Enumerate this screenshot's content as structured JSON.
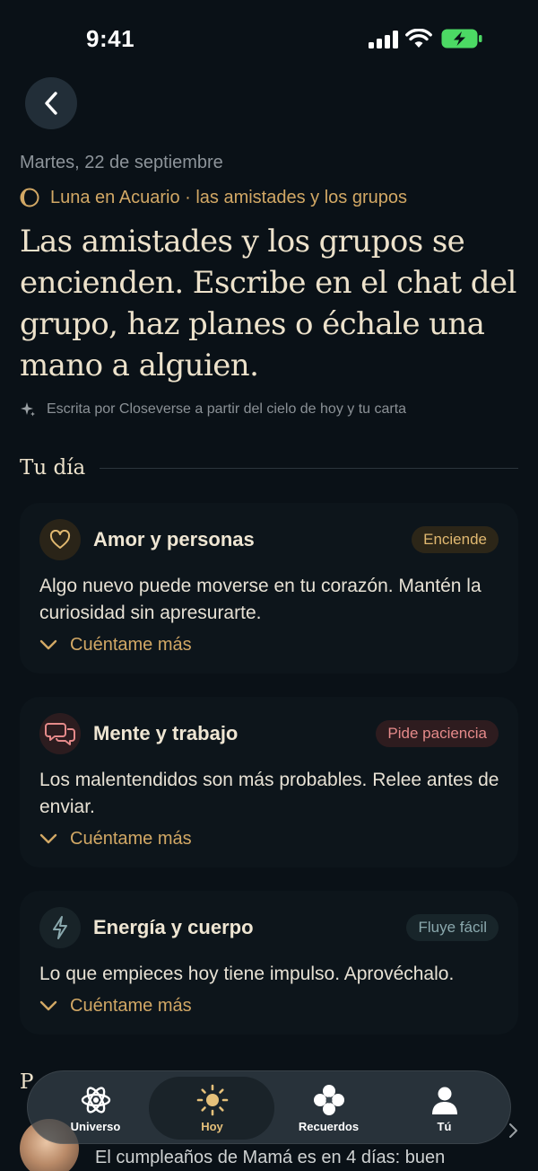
{
  "status": {
    "time": "9:41"
  },
  "header": {
    "date": "Martes, 22 de septiembre",
    "transit": "Luna en Acuario · las amistades y los grupos",
    "headline": "Las amistades y los grupos se encienden. Escribe en el chat del grupo, haz planes o échale una mano a alguien.",
    "attribution": "Escrita por Closeverse a partir del cielo de hoy y tu carta"
  },
  "section": {
    "title": "Tu día"
  },
  "cards": [
    {
      "title": "Amor y personas",
      "badge": "Enciende",
      "body": "Algo nuevo puede moverse en tu corazón. Mantén la curiosidad sin apresurarte.",
      "more": "Cuéntame más",
      "icon": "heart-icon"
    },
    {
      "title": "Mente y trabajo",
      "badge": "Pide paciencia",
      "body": "Los malentendidos son más probables. Relee antes de enviar.",
      "more": "Cuéntame más",
      "icon": "chat-bubbles-icon"
    },
    {
      "title": "Energía y cuerpo",
      "badge": "Fluye fácil",
      "body": "Lo que empieces hoy tiene impulso. Aprovéchalo.",
      "more": "Cuéntame más",
      "icon": "lightning-icon"
    }
  ],
  "below": {
    "title_partial": "P",
    "reminder": "El cumpleaños de Mamá es en 4 días: buen"
  },
  "tabs": [
    {
      "label": "Universo",
      "icon": "atom-icon",
      "active": false
    },
    {
      "label": "Hoy",
      "icon": "sun-icon",
      "active": true
    },
    {
      "label": "Recuerdos",
      "icon": "flower-icon",
      "active": false
    },
    {
      "label": "Tú",
      "icon": "person-icon",
      "active": false
    }
  ],
  "colors": {
    "background": "#0a1117",
    "accent_gold": "#d2a865",
    "badge_love": "#e0b870",
    "badge_mind": "#e58a8a",
    "badge_energy": "#8aa8ad",
    "battery": "#4cd964"
  }
}
